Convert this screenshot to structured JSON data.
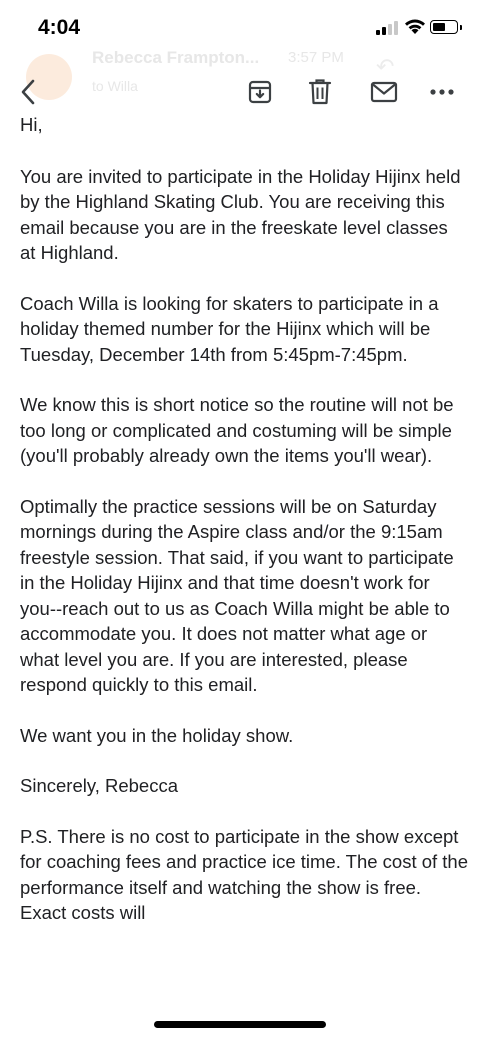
{
  "status_bar": {
    "time": "4:04"
  },
  "toolbar": {
    "back_icon": "chevron-left-icon",
    "archive_icon": "archive-icon",
    "delete_icon": "trash-icon",
    "unread_icon": "mail-icon",
    "more_icon": "more-horizontal-icon",
    "ghost_sender": "Rebecca Frampton...",
    "ghost_time": "3:57 PM",
    "ghost_to": "to Willa"
  },
  "email": {
    "paragraphs": [
      "Hi,",
      "You are invited to participate in the Holiday Hijinx held by the Highland Skating Club. You are receiving this email because you are in the freeskate level classes at Highland.",
      "Coach Willa is looking for skaters to participate in a holiday themed number for the Hijinx which will be Tuesday, December 14th from 5:45pm-7:45pm.",
      "We know this is short notice so the routine will not be too long or complicated and costuming will be simple (you'll probably already own the items you'll wear).",
      "Optimally the practice sessions will be on Saturday mornings during the Aspire class and/or the 9:15am freestyle session. That said, if you want to participate in the Holiday Hijinx and that time doesn't work for you--reach out to us as Coach Willa might be able to accommodate you. It does not matter what age or what level you are. If you are interested, please respond quickly to this email.",
      "We want you in the holiday show.",
      "Sincerely, Rebecca",
      "P.S. There is no cost to participate in the show except for coaching fees and practice ice time. The cost of the performance itself and watching the show is free. Exact costs will"
    ]
  },
  "colors": {
    "text": "#202124",
    "icon": "#3c4043",
    "background": "#ffffff"
  }
}
